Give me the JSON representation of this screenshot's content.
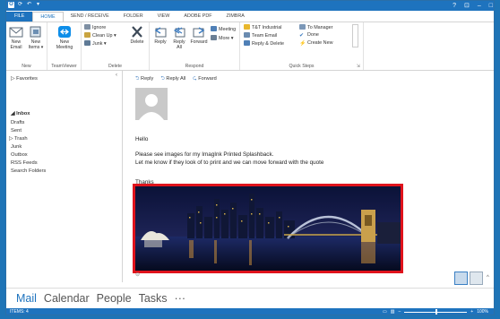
{
  "titlebar": {
    "help": "?",
    "restore": "⊡",
    "minimize": "–",
    "maximize": "□"
  },
  "tabs": [
    "FILE",
    "HOME",
    "SEND / RECEIVE",
    "FOLDER",
    "VIEW",
    "ADOBE PDF",
    "ZIMBRA"
  ],
  "ribbon": {
    "new_group": {
      "label": "New",
      "new_email": "New Email",
      "new_items": "New Items ▾"
    },
    "teamviewer_group": {
      "label": "TeamViewer",
      "new_meeting": "New Meeting"
    },
    "delete_group": {
      "label": "Delete",
      "ignore": "Ignore",
      "cleanup": "Clean Up ▾",
      "junk": "Junk ▾",
      "delete": "Delete"
    },
    "respond_group": {
      "label": "Respond",
      "reply": "Reply",
      "reply_all": "Reply All",
      "forward": "Forward",
      "meeting": "Meeting",
      "more": "More ▾"
    },
    "quicksteps_group": {
      "label": "Quick Steps",
      "s1": "T&T Industrial",
      "s2": "Team Email",
      "s3": "Reply & Delete",
      "s4": "To Manager",
      "s5": "Done",
      "s6": "Create New"
    }
  },
  "folders": {
    "favorites": "▷ Favorites",
    "inbox": "◢ Inbox",
    "items": [
      "Drafts",
      "Sent",
      "▷ Trash",
      "Junk",
      "Outbox",
      "RSS Feeds",
      "Search Folders"
    ]
  },
  "reading": {
    "reply": "Reply",
    "reply_all": "Reply All",
    "forward": "Forward",
    "body": [
      "Hello",
      "Please see images for my ImagInk Printed Splashback.",
      "Let me know if they look of to print and we can move forward with the quote",
      "Thanks"
    ]
  },
  "navbar": {
    "mail": "Mail",
    "calendar": "Calendar",
    "people": "People",
    "tasks": "Tasks",
    "more": "···"
  },
  "statusbar": {
    "items": "ITEMS: 4",
    "zoom": "100%"
  },
  "colors": {
    "accent": "#1e73be",
    "error": "#e0131c",
    "highlight": "#e0131c"
  },
  "zoom_level": 0.5
}
